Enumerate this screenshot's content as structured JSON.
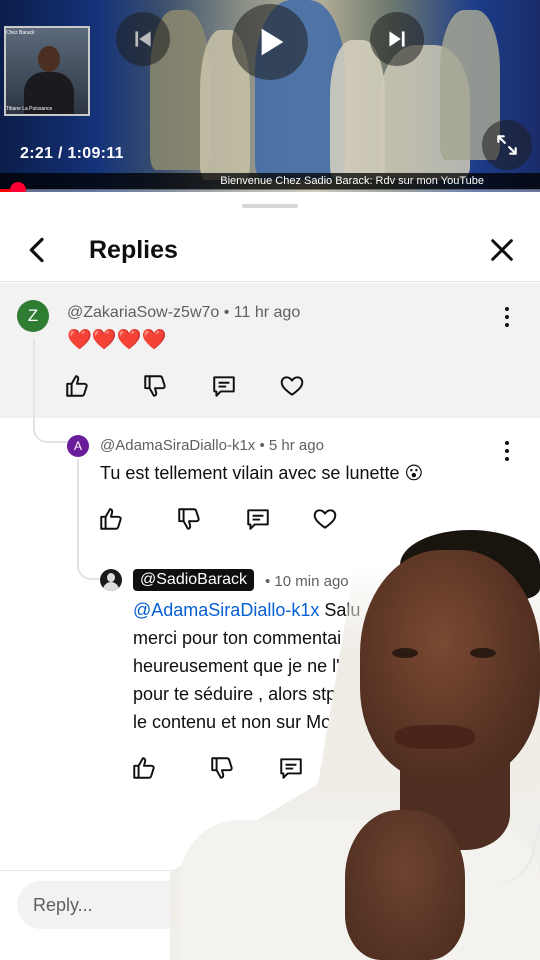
{
  "video": {
    "timecode": "2:21 / 1:09:11",
    "ticker": "Bienvenue Chez Sadio Barack: Rdv sur mon YouTube",
    "pip_top_label": "Chez Barack",
    "pip_bottom_label": "Titiane La Puissance",
    "progress_fraction": 0.034
  },
  "sheet": {
    "title": "Replies"
  },
  "comments": [
    {
      "avatar_letter": "Z",
      "author": "@ZakariaSow-z5w7o",
      "time": "11 hr ago",
      "text": "❤️❤️❤️❤️"
    },
    {
      "avatar_letter": "A",
      "author": "@AdamaSiraDiallo-k1x",
      "time": "5 hr ago",
      "text": "Tu est tellement vilain avec se lunette 😮"
    },
    {
      "author": "@SadioBarack",
      "time": "10 min ago",
      "mention": "@AdamaSiraDiallo-k1x",
      "lines": [
        " Salu",
        "merci pour ton commentai",
        "heureusement que je ne l'",
        "pour te séduire , alors stp",
        "le contenu et non sur Moi"
      ]
    }
  ],
  "reply": {
    "placeholder": "Reply..."
  },
  "icons": {
    "back": "chevron-left-icon",
    "close": "close-icon",
    "more": "more-vertical-icon",
    "like": "thumbs-up-icon",
    "dislike": "thumbs-down-icon",
    "reply": "comment-icon",
    "heart": "heart-icon"
  },
  "colors": {
    "progress": "#ff0000",
    "mention": "#065fd4",
    "avatar_z": "#2e7d32",
    "avatar_a": "#6a1b9a"
  }
}
